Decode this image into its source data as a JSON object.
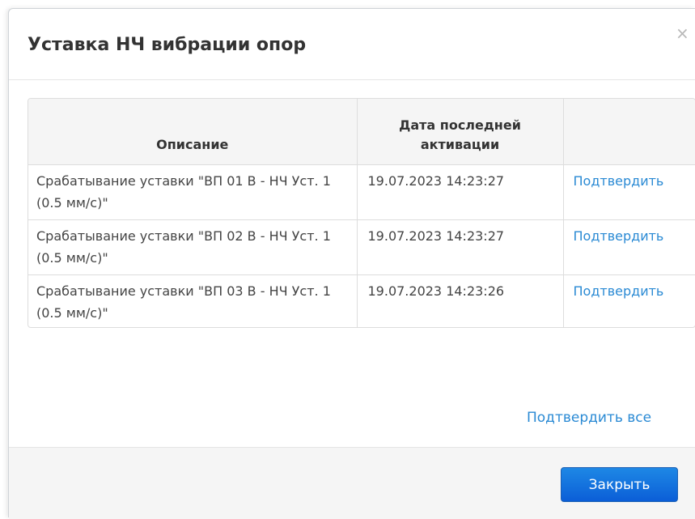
{
  "modal": {
    "title": "Уставка НЧ вибрации опор",
    "close_symbol": "×"
  },
  "table": {
    "headers": [
      "Описание",
      "Дата последней активации",
      ""
    ],
    "rows": [
      {
        "description": "Срабатывание уставки \"ВП 01 В - НЧ Уст. 1 (0.5 мм/с)\"",
        "date": "19.07.2023 14:23:27",
        "action": "Подтвердить"
      },
      {
        "description": "Срабатывание уставки \"ВП 02 В - НЧ Уст. 1 (0.5 мм/с)\"",
        "date": "19.07.2023 14:23:27",
        "action": "Подтвердить"
      },
      {
        "description": "Срабатывание уставки \"ВП 03 В - НЧ Уст. 1 (0.5 мм/с)\"",
        "date": "19.07.2023 14:23:26",
        "action": "Подтвердить"
      }
    ]
  },
  "confirm_all_label": "Подтвердить все",
  "footer": {
    "close_label": "Закрыть"
  },
  "colors": {
    "link": "#2a8ad4",
    "primary_button": "#1e88e5"
  }
}
